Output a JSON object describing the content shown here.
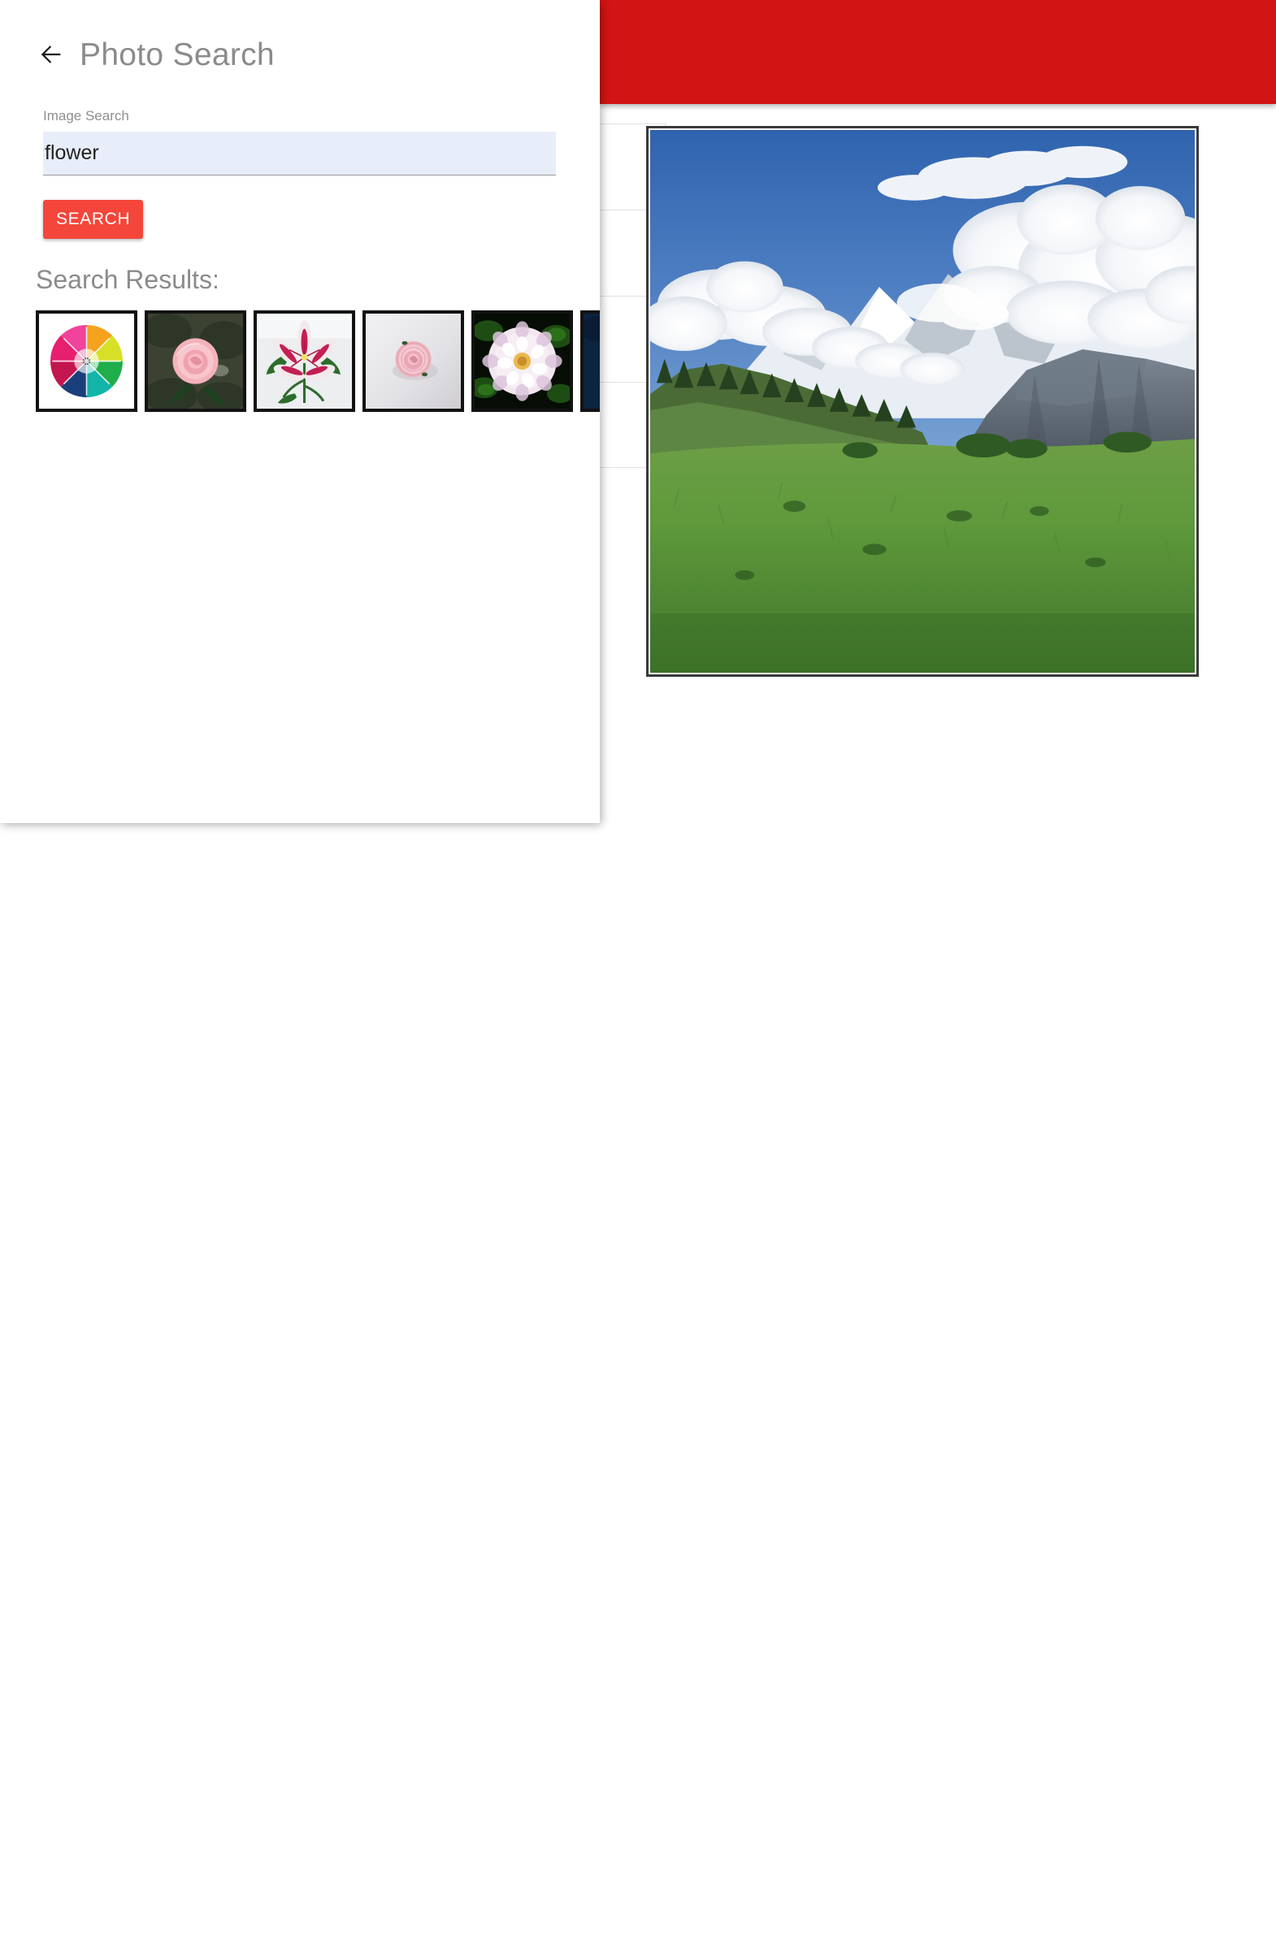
{
  "background": {
    "appbar": {
      "color": "#d21414",
      "label": ""
    },
    "list_rows": [
      {
        "label": ""
      },
      {
        "label": ""
      },
      {
        "label": ""
      },
      {
        "label": ""
      }
    ],
    "main_photo": {
      "alt": "Alpine meadow with snow-capped mountains and cumulus clouds",
      "subject": "mountain-landscape"
    }
  },
  "dialog": {
    "title": "Photo Search",
    "back_icon": "back-arrow-icon",
    "field": {
      "label": "Image Search",
      "value": "flower",
      "placeholder": ""
    },
    "search_button_label": "SEARCH",
    "results_label": "Search Results:",
    "results": [
      {
        "index": 1,
        "alt": "Rainbow-colored chrysanthemum on white background",
        "subject": "rainbow-chrysanthemum"
      },
      {
        "index": 2,
        "alt": "Pink rose in a garden with dark green foliage",
        "subject": "pink-rose-garden"
      },
      {
        "index": 3,
        "alt": "Pink and white stargazer lily against pale wall",
        "subject": "stargazer-lily"
      },
      {
        "index": 4,
        "alt": "Single pale pink rose on light grey background",
        "subject": "pale-pink-rose"
      },
      {
        "index": 5,
        "alt": "White and pink dahlia on black background",
        "subject": "white-dahlia"
      },
      {
        "index": 6,
        "alt": "Blue flower on dark navy background (clipped)",
        "subject": "blue-flower"
      }
    ]
  },
  "colors": {
    "appbar_red": "#d21414",
    "button_red": "#f4463a",
    "input_background": "#e8edfa",
    "muted_text": "#8b8b8b"
  }
}
